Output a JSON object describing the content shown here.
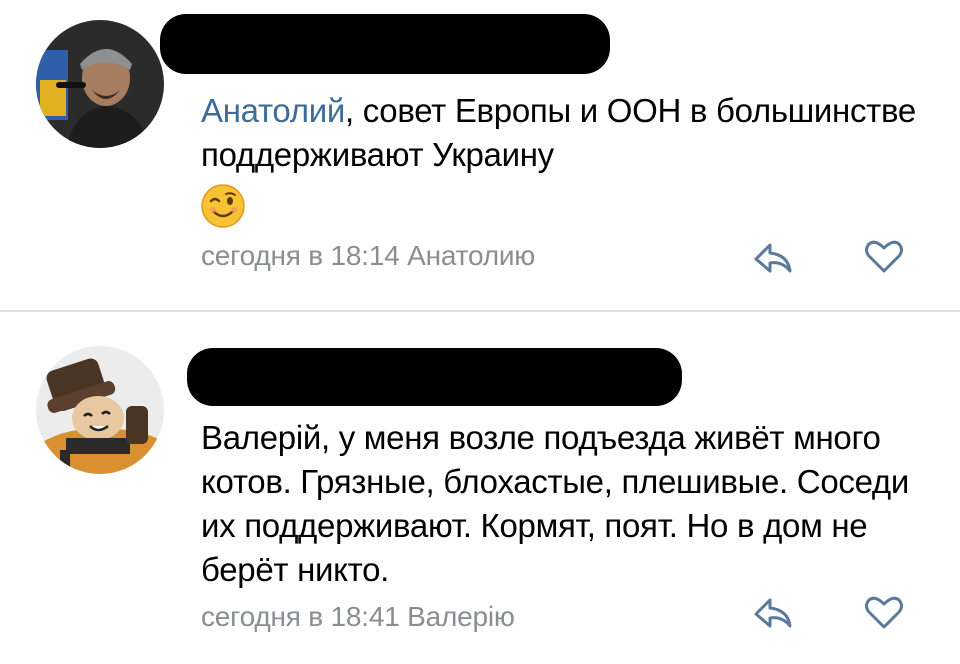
{
  "comments": [
    {
      "text_name": "Анатолий",
      "text_rest": ", совет Европы и ООН в большинстве поддерживают Украину",
      "emoji": "winking-face-emoji",
      "meta": "сегодня в 18:14 Анатолию"
    },
    {
      "text": "Валерій, у меня возле подъезда живёт много котов. Грязные, блохастые, плешивые. Соседи их поддерживают. Кормят, поят. Но в дом не берёт никто.",
      "meta": "сегодня в 18:41 Валерію"
    }
  ],
  "icons": {
    "reply": "reply-arrow-icon",
    "like": "heart-outline-icon"
  },
  "colors": {
    "name_link": "#3e6c98",
    "meta_gray": "#8a8d91",
    "divider": "#dcdfe3",
    "redaction": "#000000"
  }
}
